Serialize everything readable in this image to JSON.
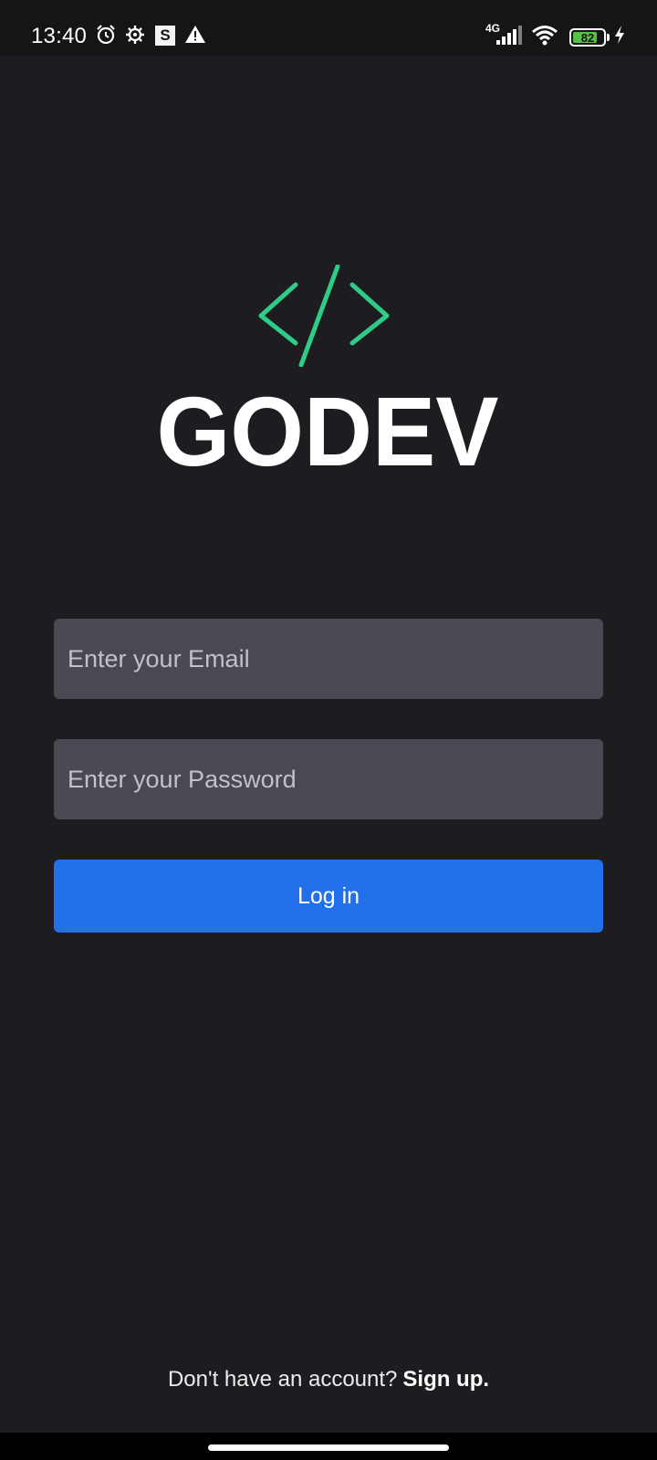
{
  "status_bar": {
    "time": "13:40",
    "network": "4G",
    "battery": "82",
    "battery_fraction": 0.82,
    "icons": [
      "alarm-icon",
      "gear-icon",
      "s-badge-icon",
      "warning-icon",
      "signal-icon",
      "wifi-icon",
      "battery-icon",
      "charging-bolt-icon"
    ]
  },
  "brand": {
    "name": "GODEV",
    "accent_color": "#2ecc87"
  },
  "form": {
    "email_placeholder": "Enter your Email",
    "password_placeholder": "Enter your Password",
    "login_label": "Log in",
    "button_color": "#2270ec",
    "field_color": "#4a4852"
  },
  "footer": {
    "prompt": "Don't have an account?",
    "signup_label": "Sign up."
  }
}
